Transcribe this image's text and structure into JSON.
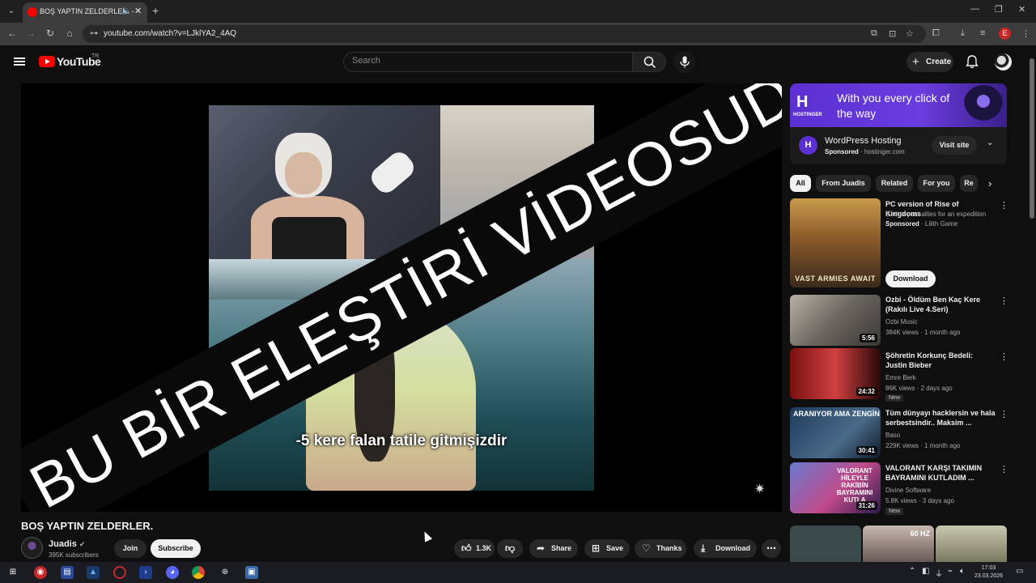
{
  "browser": {
    "tab_title": "BOŞ YAPTIN ZELDERLER. -",
    "url": "youtube.com/watch?v=LJklYA2_4AQ",
    "profile_letter": "E"
  },
  "masthead": {
    "logo_text": "YouTube",
    "country_code": "TR",
    "search_placeholder": "Search",
    "create_label": "Create"
  },
  "player": {
    "overlay_text": "BU BİR ELEŞTİRİ VİDEOSUDUR!",
    "subtitle": "-5 kere falan tatile gitmişizdir"
  },
  "video": {
    "title": "BOŞ YAPTIN ZELDERLER.",
    "channel_name": "Juadis",
    "subscribers": "395K subscribers",
    "join_label": "Join",
    "subscribe_label": "Subscribe",
    "likes": "1.3K",
    "share_label": "Share",
    "save_label": "Save",
    "thanks_label": "Thanks",
    "download_label": "Download"
  },
  "ad": {
    "logo": "H",
    "logo_sub": "HOSTINGER",
    "headline": "With you every click of the way",
    "name": "WordPress Hosting",
    "sponsored": "Sponsored",
    "domain": "· hostinger.com",
    "cta": "Visit site"
  },
  "chips": [
    "All",
    "From Juadis",
    "Related",
    "For you",
    "Re"
  ],
  "recommendations": [
    {
      "title": "PC version of Rise of Kingdoms",
      "meta1": "Gather your allies for an expedition",
      "meta2_bold": "Sponsored",
      "meta2": " · Lilith Game",
      "thumb_text": "VAST ARMIES AWAIT",
      "cta": "Download"
    },
    {
      "title": "Ozbi - Öldüm Ben Kaç Kere (Rakılı Live 4.Seri)",
      "channel": "Ozbi Music",
      "stats": "384K views · 1 month ago",
      "duration": "5:56"
    },
    {
      "title": "Şöhretin Korkunç Bedeli: Justin Bieber",
      "channel": "Emre Berk",
      "stats": "86K views · 2 days ago",
      "duration": "24:32",
      "badge": "New"
    },
    {
      "title": "Tüm dünyayı hacklersin ve hala serbestsindir.. Maksim ...",
      "channel": "Baso",
      "stats": "229K views · 1 month ago",
      "duration": "30:41",
      "thumb_text": "ARANIYOR AMA ZENGİN"
    },
    {
      "title": "VALORANT KARŞI TAKIMIN BAYRAMINI KUTLADIM ...",
      "channel": "Divine Software",
      "stats": "5.8K views · 3 days ago",
      "duration": "31:26",
      "badge": "New",
      "thumb_text": "VALORANT HİLEYLE RAKİBİN BAYRAMINI KUTLA"
    }
  ],
  "partial_thumb_text": "60 HZ",
  "taskbar": {
    "time": "17:03",
    "date": "23.03.2026"
  },
  "colors": {
    "background": "#0f0f0f",
    "youtube_red": "#ff0000",
    "ad_purple": "#5b2fd1"
  }
}
